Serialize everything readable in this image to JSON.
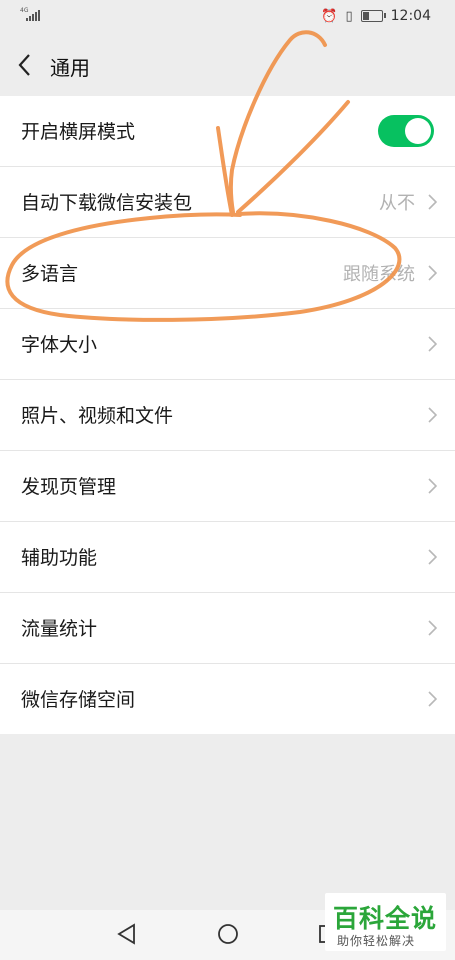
{
  "status_bar": {
    "network": "4G",
    "time": "12:04",
    "icons": [
      "signal-icon",
      "alarm-icon",
      "vibrate-icon",
      "battery-icon"
    ]
  },
  "navbar": {
    "title": "通用",
    "back_icon": "chevron-left-icon"
  },
  "settings": {
    "items": [
      {
        "label": "开启横屏模式",
        "toggle_on": true
      },
      {
        "label": "自动下载微信安装包",
        "value": "从不"
      },
      {
        "label": "多语言",
        "value": "跟随系统"
      },
      {
        "label": "字体大小"
      },
      {
        "label": "照片、视频和文件"
      },
      {
        "label": "发现页管理"
      },
      {
        "label": "辅助功能"
      },
      {
        "label": "流量统计"
      },
      {
        "label": "微信存储空间"
      }
    ]
  },
  "colors": {
    "accent": "#07c160",
    "background": "#ededed",
    "annotation": "#f0924a"
  },
  "watermark": {
    "title": "百科全说",
    "subtitle": "助你轻松解决"
  },
  "system_nav": {
    "icons": [
      "back-triangle-icon",
      "home-circle-icon",
      "recents-square-icon"
    ]
  }
}
